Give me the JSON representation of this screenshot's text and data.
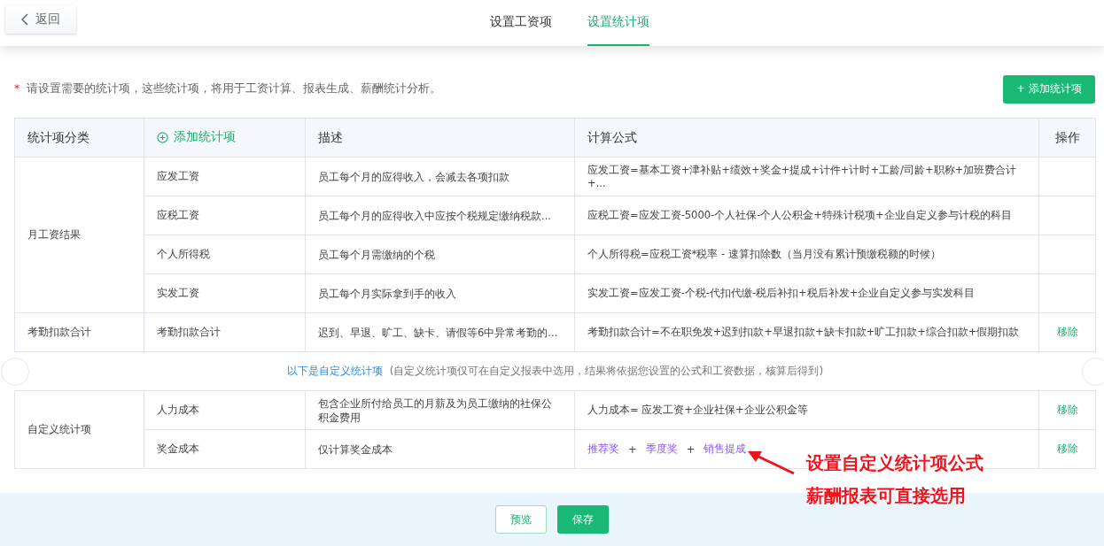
{
  "header": {
    "back_button": "返回",
    "tabs": [
      {
        "label": "设置工资项",
        "selected": false
      },
      {
        "label": "设置统计项",
        "selected": true
      }
    ]
  },
  "notice": {
    "required_mark": "*",
    "text": "请设置需要的统计项，这些统计项，将用于工资计算、报表生成、薪酬统计分析。"
  },
  "add_button": "+ 添加统计项",
  "table": {
    "columns": [
      {
        "label": "统计项分类",
        "kind": "text"
      },
      {
        "label": "添加统计项",
        "kind": "add"
      },
      {
        "label": "描述",
        "kind": "text"
      },
      {
        "label": "计算公式",
        "kind": "text"
      },
      {
        "label": "操作",
        "kind": "text"
      }
    ],
    "groups": [
      {
        "category": "月工资结果",
        "items": [
          {
            "name": "应发工资",
            "description": "员工每个月的应得收入，会减去各项扣款",
            "kind": "text",
            "formula": "应发工资=基本工资+津补贴+绩效+奖金+提成+计件+计时+工龄/司龄+职称+加班费合计+..."
          },
          {
            "name": "应税工资",
            "description": "员工每个月的应得收入中应按个税规定缴纳税款...",
            "kind": "text",
            "formula": "应税工资=应发工资-5000-个人社保-个人公积金+特殊计税项+企业自定义参与计税的科目"
          },
          {
            "name": "个人所得税",
            "description": "员工每个月需缴纳的个税",
            "kind": "text",
            "formula": "个人所得税=应税工资*税率 - 速算扣除数（当月没有累计预缴税额的时候）"
          },
          {
            "name": "实发工资",
            "description": "员工每个月实际拿到手的收入",
            "kind": "text",
            "formula": "实发工资=应发工资-个税-代扣代缴-税后补扣+税后补发+企业自定义参与实发科目"
          }
        ]
      },
      {
        "category": "考勤扣款合计",
        "items": [
          {
            "name": "考勤扣款合计",
            "description": "迟到、早退、旷工、缺卡、请假等6中异常考勤的...",
            "kind": "text",
            "formula": "考勤扣款合计=不在职免发+迟到扣款+早退扣款+缺卡扣款+旷工扣款+综合扣款+假期扣款",
            "action": "移除"
          }
        ]
      },
      {
        "kind": "note",
        "link": "以下是自定义统计项",
        "text": "(自定义统计项仅可在自定义报表中选用，结果将依据您设置的公式和工资数据，核算后得到)"
      },
      {
        "category": "自定义统计项",
        "items": [
          {
            "name": "人力成本",
            "description": "包含企业所付给员工的月薪及为员工缴纳的社保公积金费用",
            "kind": "text",
            "formula": "人力成本= 应发工资+企业社保+企业公积金等",
            "action": "移除"
          },
          {
            "name": "奖金成本",
            "description": "仅计算奖金成本",
            "kind": "tokens",
            "tokens": [
              "推荐奖",
              "+",
              "季度奖",
              "+",
              "销售提成"
            ],
            "action": "移除"
          }
        ]
      }
    ]
  },
  "footer": {
    "buttons": [
      {
        "label": "预览",
        "kind": "secondary"
      },
      {
        "label": "保存",
        "kind": "primary"
      }
    ]
  },
  "annotation": {
    "lines": [
      "设置自定义统计项公式",
      "薪酬报表可直接选用"
    ]
  }
}
